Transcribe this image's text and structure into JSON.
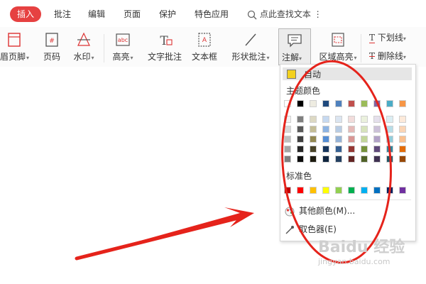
{
  "tabs": [
    {
      "label": "插入",
      "active": true
    },
    {
      "label": "批注",
      "active": false
    },
    {
      "label": "编辑",
      "active": false
    },
    {
      "label": "页面",
      "active": false
    },
    {
      "label": "保护",
      "active": false
    },
    {
      "label": "特色应用",
      "active": false
    }
  ],
  "search": {
    "label": "点此查找文本",
    "more": "⋮"
  },
  "ribbon": {
    "header_footer": "眉页脚",
    "page_number": "页码",
    "watermark": "水印",
    "highlight": "高亮",
    "text_comment": "文字批注",
    "text_box": "文本框",
    "shape_comment": "形状批注",
    "annotation": "注解",
    "area_highlight": "区域高亮",
    "underline": "下划线",
    "strikethrough": "删除线"
  },
  "dropdown": {
    "auto_label": "自动",
    "theme_label": "主题颜色",
    "standard_label": "标准色",
    "more_colors": "其他颜色(M)...",
    "eyedropper": "取色器(E)",
    "auto_color": "#f3d11d",
    "theme_colors": [
      [
        "#ffffff",
        "#000000",
        "#eeece1",
        "#1f497d",
        "#4f81bd",
        "#c0504d",
        "#9bbb59",
        "#8064a2",
        "#4bacc6",
        "#f79646"
      ],
      [
        "#f2f2f2",
        "#7f7f7f",
        "#ddd9c3",
        "#c6d9f0",
        "#dbe5f1",
        "#f2dcdb",
        "#ebf1dd",
        "#e5e0ec",
        "#dbeef3",
        "#fdeada"
      ],
      [
        "#d8d8d8",
        "#595959",
        "#c4bd97",
        "#8db3e2",
        "#b8cce4",
        "#e5b9b7",
        "#d7e3bc",
        "#ccc1d9",
        "#b7dde8",
        "#fbd5b5"
      ],
      [
        "#bfbfbf",
        "#3f3f3f",
        "#938953",
        "#548dd4",
        "#95b3d7",
        "#d99694",
        "#c3d69b",
        "#b2a2c7",
        "#92cddc",
        "#fac08f"
      ],
      [
        "#a5a5a5",
        "#262626",
        "#494429",
        "#17365d",
        "#366092",
        "#953734",
        "#76923c",
        "#5f497a",
        "#31859b",
        "#e36c09"
      ],
      [
        "#7f7f7f",
        "#0c0c0c",
        "#1d1b10",
        "#0f243e",
        "#244061",
        "#632423",
        "#4f6128",
        "#3f3151",
        "#205867",
        "#974806"
      ]
    ],
    "standard_colors": [
      "#c00000",
      "#ff0000",
      "#ffc000",
      "#ffff00",
      "#92d050",
      "#00b050",
      "#00b0f0",
      "#0070c0",
      "#002060",
      "#7030a0"
    ]
  },
  "watermark": {
    "brand": "Baidu 经验",
    "url": "jingyan.baidu.com"
  }
}
